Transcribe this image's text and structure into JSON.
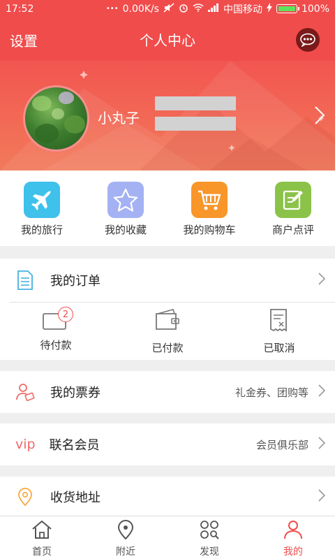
{
  "status": {
    "time": "17:52",
    "speed": "0.00K/s",
    "carrier": "中国移动",
    "battery": "100%"
  },
  "header": {
    "settings": "设置",
    "title": "个人中心",
    "message_icon": "message-bubble-icon"
  },
  "profile": {
    "username": "小丸子"
  },
  "quick_actions": [
    {
      "label": "我的旅行",
      "icon": "airplane-icon",
      "color": "#3ec1ea"
    },
    {
      "label": "我的收藏",
      "icon": "star-icon",
      "color": "#a4b2f3"
    },
    {
      "label": "我的购物车",
      "icon": "cart-icon",
      "color": "#f8962a"
    },
    {
      "label": "商户点评",
      "icon": "edit-note-icon",
      "color": "#8bc34a"
    }
  ],
  "orders": {
    "title": "我的订单",
    "items": [
      {
        "label": "待付款",
        "badge": "2"
      },
      {
        "label": "已付款"
      },
      {
        "label": "已取消"
      }
    ]
  },
  "tickets": {
    "label": "我的票券",
    "sub": "礼金券、团购等"
  },
  "vip": {
    "icon_text": "vip",
    "label": "联名会员",
    "sub": "会员俱乐部"
  },
  "address": {
    "label": "收货地址"
  },
  "nav": [
    {
      "label": "首页",
      "icon": "home-icon"
    },
    {
      "label": "附近",
      "icon": "location-pin-icon"
    },
    {
      "label": "发现",
      "icon": "discover-grid-icon"
    },
    {
      "label": "我的",
      "icon": "person-icon",
      "active": true
    }
  ],
  "colors": {
    "brand": "#f04c4c"
  }
}
